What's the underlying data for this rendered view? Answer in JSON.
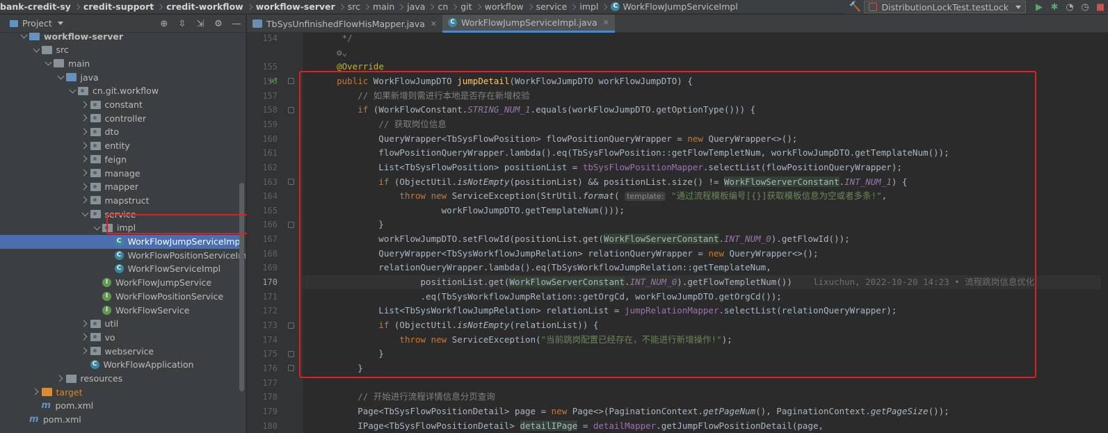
{
  "breadcrumbs": [
    {
      "label": "bank-credit-sy",
      "bold": true
    },
    {
      "label": "credit-support",
      "bold": true
    },
    {
      "label": "credit-workflow",
      "bold": true
    },
    {
      "label": "workflow-server",
      "bold": true
    },
    {
      "label": "src",
      "bold": false
    },
    {
      "label": "main",
      "bold": false
    },
    {
      "label": "java",
      "bold": false
    },
    {
      "label": "cn",
      "bold": false
    },
    {
      "label": "git",
      "bold": false
    },
    {
      "label": "workflow",
      "bold": false
    },
    {
      "label": "service",
      "bold": false
    },
    {
      "label": "impl",
      "bold": false
    },
    {
      "label": "WorkFlowJumpServiceImpl",
      "bold": false,
      "icon": "class-icon"
    }
  ],
  "toolbar": {
    "run_config": "DistributionLockTest.testLock"
  },
  "project_panel": {
    "title": "Project"
  },
  "tree": [
    {
      "label": "workflow-server",
      "depth": 1,
      "arrow": "open",
      "icon": "module-folder",
      "cut": true
    },
    {
      "label": "src",
      "depth": 2,
      "arrow": "open",
      "icon": "folder"
    },
    {
      "label": "main",
      "depth": 3,
      "arrow": "open",
      "icon": "folder"
    },
    {
      "label": "java",
      "depth": 4,
      "arrow": "open",
      "icon": "source-folder"
    },
    {
      "label": "cn.git.workflow",
      "depth": 5,
      "arrow": "open",
      "icon": "package"
    },
    {
      "label": "constant",
      "depth": 6,
      "arrow": "closed",
      "icon": "package"
    },
    {
      "label": "controller",
      "depth": 6,
      "arrow": "closed",
      "icon": "package"
    },
    {
      "label": "dto",
      "depth": 6,
      "arrow": "closed",
      "icon": "package"
    },
    {
      "label": "entity",
      "depth": 6,
      "arrow": "closed",
      "icon": "package"
    },
    {
      "label": "feign",
      "depth": 6,
      "arrow": "closed",
      "icon": "package"
    },
    {
      "label": "manage",
      "depth": 6,
      "arrow": "closed",
      "icon": "package"
    },
    {
      "label": "mapper",
      "depth": 6,
      "arrow": "closed",
      "icon": "package"
    },
    {
      "label": "mapstruct",
      "depth": 6,
      "arrow": "closed",
      "icon": "package"
    },
    {
      "label": "service",
      "depth": 6,
      "arrow": "open",
      "icon": "package"
    },
    {
      "label": "impl",
      "depth": 7,
      "arrow": "open",
      "icon": "package"
    },
    {
      "label": "WorkFlowJumpServiceImpl",
      "depth": 8,
      "arrow": "none",
      "icon": "class",
      "selected": true
    },
    {
      "label": "WorkFlowPositionServiceImpl",
      "depth": 8,
      "arrow": "none",
      "icon": "class"
    },
    {
      "label": "WorkFlowServiceImpl",
      "depth": 8,
      "arrow": "none",
      "icon": "class"
    },
    {
      "label": "WorkFlowJumpService",
      "depth": 7,
      "arrow": "none",
      "icon": "interface"
    },
    {
      "label": "WorkFlowPositionService",
      "depth": 7,
      "arrow": "none",
      "icon": "interface"
    },
    {
      "label": "WorkFlowService",
      "depth": 7,
      "arrow": "none",
      "icon": "interface"
    },
    {
      "label": "util",
      "depth": 6,
      "arrow": "closed",
      "icon": "package"
    },
    {
      "label": "vo",
      "depth": 6,
      "arrow": "closed",
      "icon": "package"
    },
    {
      "label": "webservice",
      "depth": 6,
      "arrow": "closed",
      "icon": "package"
    },
    {
      "label": "WorkFlowApplication",
      "depth": 6,
      "arrow": "none",
      "icon": "class"
    },
    {
      "label": "resources",
      "depth": 4,
      "arrow": "closed",
      "icon": "folder"
    },
    {
      "label": "target",
      "depth": 2,
      "arrow": "closed",
      "icon": "excluded-folder"
    },
    {
      "label": "pom.xml",
      "depth": 2,
      "arrow": "none",
      "icon": "maven"
    },
    {
      "label": "pom.xml",
      "depth": 1,
      "arrow": "none",
      "icon": "maven"
    }
  ],
  "tabs": [
    {
      "label": "TbSysUnfinishedFlowHisMapper.java",
      "active": false
    },
    {
      "label": "WorkFlowJumpServiceImpl.java",
      "active": true
    }
  ],
  "editor": {
    "first_line": 154,
    "current_line": 170,
    "lines": [
      {
        "n": "154",
        "html": "     <span class=\"cm\">*/</span>"
      },
      {
        "n": "",
        "html": "    <span class=\"cm\">⚙⌄</span>"
      },
      {
        "n": "155",
        "html": "    <span class=\"an\">@Override</span>"
      },
      {
        "n": "156",
        "html": "    <span class=\"kw\">public </span>WorkFlowJumpDTO <span class=\"fn\">jumpDetail</span>(WorkFlowJumpDTO workFlowJumpDTO) {"
      },
      {
        "n": "157",
        "html": "        <span class=\"cm\">// 如果新增则需进行本地是否存在新增校验</span>"
      },
      {
        "n": "158",
        "html": "        <span class=\"kw\">if </span>(WorkFlowConstant.<span class=\"cst\">STRING_NUM_1</span>.equals(workFlowJumpDTO.getOptionType())) {"
      },
      {
        "n": "159",
        "html": "            <span class=\"cm\">// 获取岗位信息</span>"
      },
      {
        "n": "160",
        "html": "            QueryWrapper&lt;TbSysFlowPosition&gt; flowPositionQueryWrapper = <span class=\"kw\">new </span>QueryWrapper&lt;&gt;();"
      },
      {
        "n": "161",
        "html": "            flowPositionQueryWrapper.lambda().eq(TbSysFlowPosition::getFlowTempletNum, workFlowJumpDTO.getTemplateNum());"
      },
      {
        "n": "162",
        "html": "            List&lt;TbSysFlowPosition&gt; positionList = <span class=\"fld\">tbSysFlowPositionMapper</span>.selectList(flowPositionQueryWrapper);"
      },
      {
        "n": "163",
        "html": "            <span class=\"kw\">if </span>(ObjectUtil.<span class=\"si\">isNotEmpty</span>(positionList) &amp;&amp; positionList.size() != <span class=\"hl\">WorkFlowServerConstant</span>.<span class=\"cst\">INT_NUM_1</span>) {"
      },
      {
        "n": "164",
        "html": "                <span class=\"kw\">throw new </span>ServiceException(StrUtil.<span class=\"si\">format</span>( <span class=\"hint\">template:</span> <span class=\"st\">\"通过流程模板编号[{}]获取模板信息为空或者多条!\"</span>,"
      },
      {
        "n": "165",
        "html": "                        workFlowJumpDTO.getTemplateNum()));"
      },
      {
        "n": "166",
        "html": "            }"
      },
      {
        "n": "167",
        "html": "            workFlowJumpDTO.setFlowId(positionList.get(<span class=\"hl\">WorkFlowServerConstant</span>.<span class=\"cst\">INT_NUM_0</span>).getFlowId());"
      },
      {
        "n": "168",
        "html": "            QueryWrapper&lt;TbSysWorkflowJumpRelation&gt; relationQueryWrapper = <span class=\"kw\">new </span>QueryWrapper&lt;&gt;();"
      },
      {
        "n": "169",
        "html": "            relationQueryWrapper.lambda().eq(TbSysWorkflowJumpRelation::getTemplateNum,"
      },
      {
        "n": "170",
        "html": "                    positionList.get(<span class=\"hl\">WorkFlowServerConstant</span>.<span class=\"cst\">INT_NUM_0</span>).getFlowTempletNum())    <span class=\"blame\">lixuchun, 2022-10-20 14:23 • 流程跳岗信息优化</span>"
      },
      {
        "n": "171",
        "html": "                    .eq(TbSysWorkflowJumpRelation::getOrgCd, workFlowJumpDTO.getOrgCd());"
      },
      {
        "n": "172",
        "html": "            List&lt;TbSysWorkflowJumpRelation&gt; relationList = <span class=\"fld\">jumpRelationMapper</span>.selectList(relationQueryWrapper);"
      },
      {
        "n": "173",
        "html": "            <span class=\"kw\">if </span>(ObjectUtil.<span class=\"si\">isNotEmpty</span>(relationList)) {"
      },
      {
        "n": "174",
        "html": "                <span class=\"kw\">throw new </span>ServiceException(<span class=\"st\">\"当前跳岗配置已经存在，不能进行新增操作!\"</span>);"
      },
      {
        "n": "175",
        "html": "            }"
      },
      {
        "n": "176",
        "html": "        }"
      },
      {
        "n": "177",
        "html": ""
      },
      {
        "n": "178",
        "html": "        <span class=\"cm\">// 开始进行流程详情信息分页查询</span>"
      },
      {
        "n": "179",
        "html": "        Page&lt;TbSysFlowPositionDetail&gt; page = <span class=\"kw\">new </span>Page&lt;&gt;(PaginationContext.<span class=\"si\">getPageNum</span>(), PaginationContext.<span class=\"si\">getPageSize</span>());"
      },
      {
        "n": "180",
        "html": "        IPage&lt;TbSysFlowPositionDetail&gt; <span class=\"hl\">detailIPage</span> = <span class=\"fld\">detailMapper</span>.getJumpFlowPositionDetail(page,"
      }
    ]
  }
}
